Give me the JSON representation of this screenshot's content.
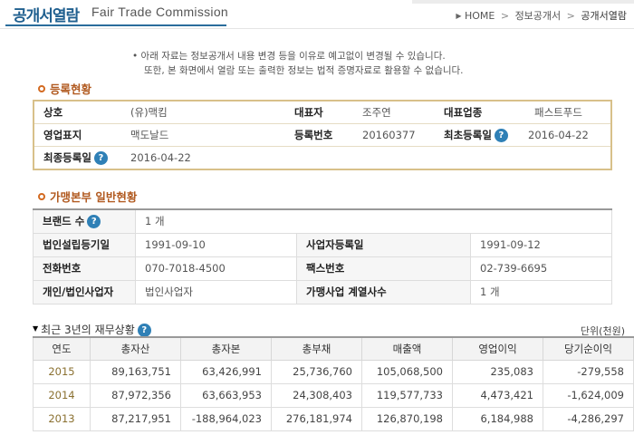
{
  "header": {
    "title": "공개서열람",
    "title_en": "Fair Trade Commission",
    "breadcrumb": [
      "HOME",
      "정보공개서",
      "공개서열람"
    ]
  },
  "notice": [
    "• 아래 자료는 정보공개서 내용 변경 등을 이유로 예고없이 변경될 수 있습니다.",
    "또한, 본 화면에서 열람 또는 출력한 정보는 법적 증명자료로 활용할 수 없습니다."
  ],
  "registration": {
    "heading": "등록현황",
    "company_label": "상호",
    "company_value": "(유)맥킴",
    "ceo_label": "대표자",
    "ceo_value": "조주연",
    "industry_label": "대표업종",
    "industry_value": "패스트푸드",
    "brand_label": "영업표지",
    "brand_value": "맥도날드",
    "regno_label": "등록번호",
    "regno_value": "20160377",
    "first_reg_label": "최초등록일",
    "first_reg_value": "2016-04-22",
    "last_reg_label": "최종등록일",
    "last_reg_value": "2016-04-22",
    "help_glyph": "?"
  },
  "general": {
    "heading": "가맹본부 일반현황",
    "brand_count_label": "브랜드 수",
    "brand_count_value": "1 개",
    "corp_date_label": "법인설립등기일",
    "corp_date_value": "1991-09-10",
    "biz_reg_label": "사업자등록일",
    "biz_reg_value": "1991-09-12",
    "phone_label": "전화번호",
    "phone_value": "070-7018-4500",
    "fax_label": "팩스번호",
    "fax_value": "02-739-6695",
    "entity_label": "개인/법인사업자",
    "entity_value": "법인사업자",
    "affiliates_label": "가맹사업 계열사수",
    "affiliates_value": "1 개"
  },
  "finance": {
    "title": "최근 3년의 재무상황",
    "unit": "단위(천원)",
    "headers": [
      "연도",
      "총자산",
      "총자본",
      "총부채",
      "매출액",
      "영업이익",
      "당기순이익"
    ],
    "rows": [
      [
        "2015",
        "89,163,751",
        "63,426,991",
        "25,736,760",
        "105,068,500",
        "235,083",
        "-279,558"
      ],
      [
        "2014",
        "87,972,356",
        "63,663,953",
        "24,308,403",
        "119,577,733",
        "4,473,421",
        "-1,624,009"
      ],
      [
        "2013",
        "87,217,951",
        "-188,964,023",
        "276,181,974",
        "126,870,198",
        "6,184,988",
        "-4,286,297"
      ]
    ]
  }
}
